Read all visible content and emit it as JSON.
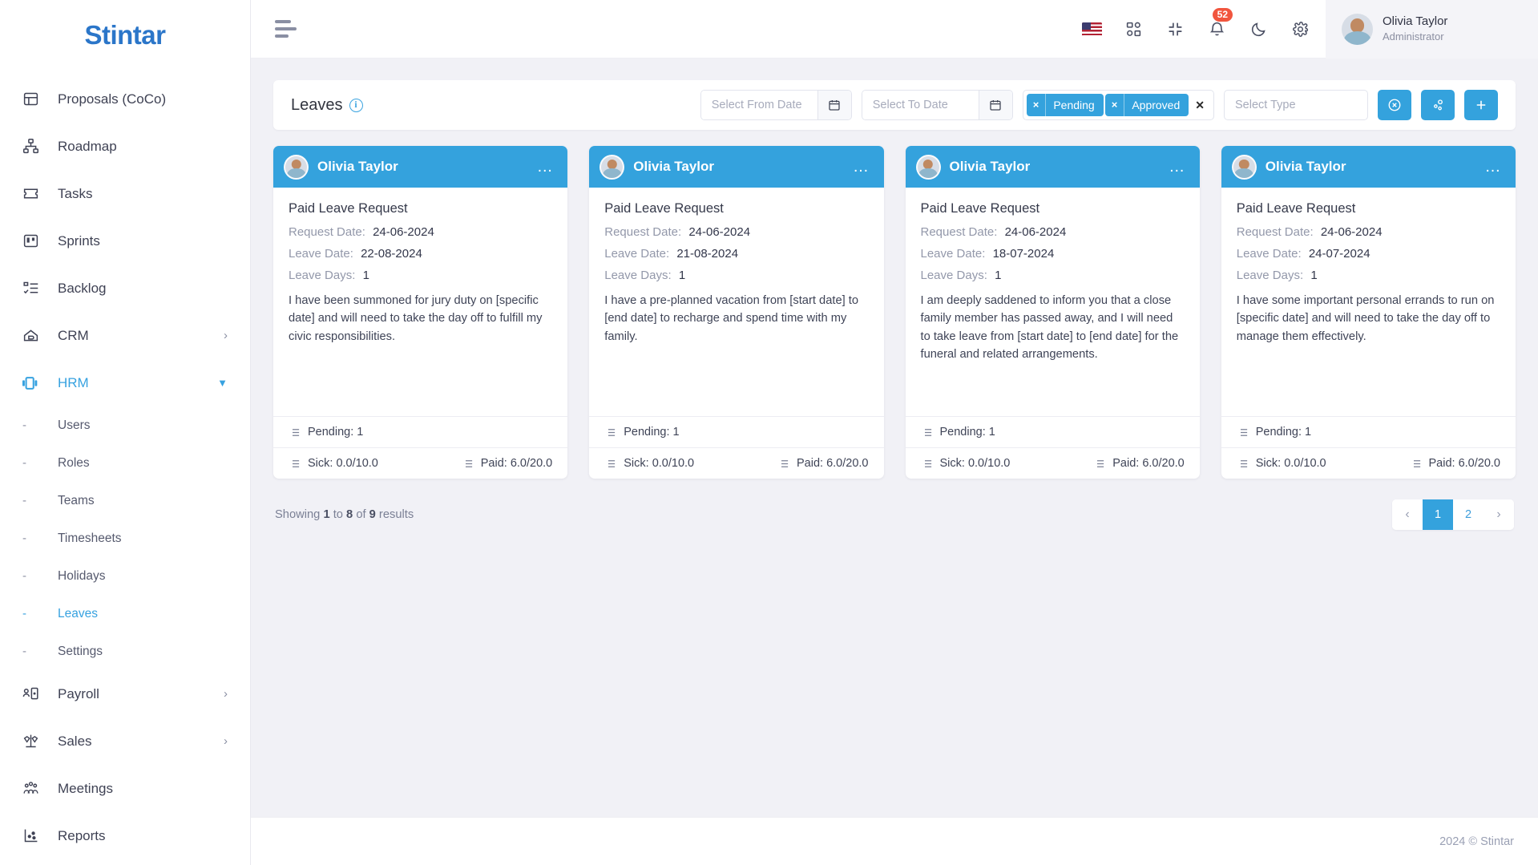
{
  "brand": {
    "name": "Stintar"
  },
  "sidebar": {
    "items": [
      {
        "label": "Proposals (CoCo)",
        "icon": "proposals-icon",
        "chevron": ""
      },
      {
        "label": "Roadmap",
        "icon": "roadmap-icon",
        "chevron": ""
      },
      {
        "label": "Tasks",
        "icon": "tasks-icon",
        "chevron": ""
      },
      {
        "label": "Sprints",
        "icon": "sprints-icon",
        "chevron": ""
      },
      {
        "label": "Backlog",
        "icon": "backlog-icon",
        "chevron": ""
      },
      {
        "label": "CRM",
        "icon": "crm-icon",
        "chevron": "›"
      },
      {
        "label": "HRM",
        "icon": "hrm-icon",
        "chevron": "⌄",
        "active": true
      }
    ],
    "hrm_children": [
      {
        "label": "Users",
        "dash": "-"
      },
      {
        "label": "Roles",
        "dash": "-"
      },
      {
        "label": "Teams",
        "dash": "-"
      },
      {
        "label": "Timesheets",
        "dash": "-"
      },
      {
        "label": "Holidays",
        "dash": "-"
      },
      {
        "label": "Leaves",
        "dash": "-",
        "active": true
      },
      {
        "label": "Settings",
        "dash": "-"
      }
    ],
    "items_after": [
      {
        "label": "Payroll",
        "icon": "payroll-icon",
        "chevron": "›"
      },
      {
        "label": "Sales",
        "icon": "sales-icon",
        "chevron": "›"
      },
      {
        "label": "Meetings",
        "icon": "meetings-icon",
        "chevron": ""
      },
      {
        "label": "Reports",
        "icon": "reports-icon",
        "chevron": ""
      }
    ]
  },
  "topbar": {
    "menu_toggle": "menu-toggle-icon",
    "language_flag": "us-flag-icon",
    "apps_icon": "apps-grid-icon",
    "fullscreen_icon": "collapse-fullscreen-icon",
    "notifications_icon": "bell-icon",
    "notifications_count": "52",
    "theme_icon": "moon-icon",
    "settings_icon": "gear-icon",
    "profile": {
      "name": "Olivia Taylor",
      "role": "Administrator",
      "avatar": "user-avatar"
    }
  },
  "filterbar": {
    "title": "Leaves",
    "info_icon": "info-icon",
    "from_date": {
      "placeholder": "Select From Date",
      "value": ""
    },
    "to_date": {
      "placeholder": "Select To Date",
      "value": ""
    },
    "status_tags": [
      {
        "label": "Pending",
        "remove": "×"
      },
      {
        "label": "Approved",
        "remove": "×"
      }
    ],
    "tags_clear_all": "✕",
    "type_select": {
      "placeholder": "Select Type",
      "value": ""
    },
    "buttons": [
      {
        "name": "clear-filters-button",
        "icon": "circle-x-icon"
      },
      {
        "name": "filter-options-button",
        "icon": "nodes-icon"
      },
      {
        "name": "add-leave-button",
        "icon": "plus-icon"
      }
    ],
    "accent_color": "#34a2dd"
  },
  "cards": [
    {
      "user": "Olivia Taylor",
      "menu": "…",
      "title": "Paid Leave Request",
      "request_date_label": "Request Date:",
      "request_date": "24-06-2024",
      "leave_date_label": "Leave Date:",
      "leave_date": "22-08-2024",
      "leave_days_label": "Leave Days:",
      "leave_days": "1",
      "description": "I have been summoned for jury duty on [specific date] and will need to take the day off to fulfill my civic responsibilities.",
      "status": "Pending: 1",
      "sick": "Sick: 0.0/10.0",
      "paid": "Paid: 6.0/20.0"
    },
    {
      "user": "Olivia Taylor",
      "menu": "…",
      "title": "Paid Leave Request",
      "request_date_label": "Request Date:",
      "request_date": "24-06-2024",
      "leave_date_label": "Leave Date:",
      "leave_date": "21-08-2024",
      "leave_days_label": "Leave Days:",
      "leave_days": "1",
      "description": "I have a pre-planned vacation from [start date] to [end date] to recharge and spend time with my family.",
      "status": "Pending: 1",
      "sick": "Sick: 0.0/10.0",
      "paid": "Paid: 6.0/20.0"
    },
    {
      "user": "Olivia Taylor",
      "menu": "…",
      "title": "Paid Leave Request",
      "request_date_label": "Request Date:",
      "request_date": "24-06-2024",
      "leave_date_label": "Leave Date:",
      "leave_date": "18-07-2024",
      "leave_days_label": "Leave Days:",
      "leave_days": "1",
      "description": "I am deeply saddened to inform you that a close family member has passed away, and I will need to take leave from [start date] to [end date] for the funeral and related arrangements.",
      "status": "Pending: 1",
      "sick": "Sick: 0.0/10.0",
      "paid": "Paid: 6.0/20.0"
    },
    {
      "user": "Olivia Taylor",
      "menu": "…",
      "title": "Paid Leave Request",
      "request_date_label": "Request Date:",
      "request_date": "24-06-2024",
      "leave_date_label": "Leave Date:",
      "leave_date": "24-07-2024",
      "leave_days_label": "Leave Days:",
      "leave_days": "1",
      "description": "I have some important personal errands to run on [specific date] and will need to take the day off to manage them effectively.",
      "status": "Pending: 1",
      "sick": "Sick: 0.0/10.0",
      "paid": "Paid: 6.0/20.0"
    }
  ],
  "pagination": {
    "showing_prefix": "Showing",
    "from": "1",
    "to_word": "to",
    "to": "8",
    "of_word": "of",
    "total": "9",
    "results_word": "results",
    "prev": "‹",
    "next": "›",
    "pages": [
      "1",
      "2"
    ],
    "current_page": "1"
  },
  "footer": {
    "copyright": "2024 © Stintar"
  }
}
